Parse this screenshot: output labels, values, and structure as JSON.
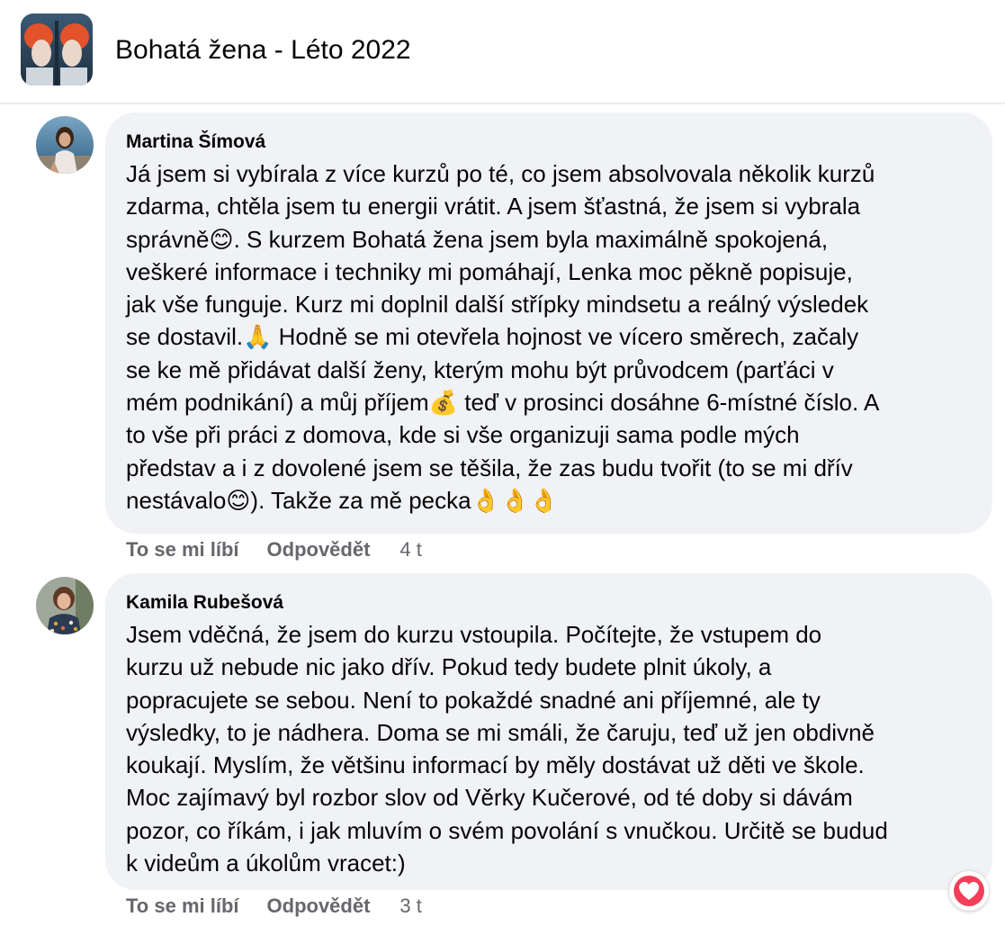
{
  "header": {
    "group_title": "Bohatá žena - Léto 2022",
    "group_avatar_icon": "group-photo-icon"
  },
  "comments": [
    {
      "author": "Martina Šímová",
      "lines": [
        "Já jsem si vybírala z více kurzů po té, co jsem absolvovala několik kurzů",
        "zdarma, chtěla jsem tu energii vrátit. A jsem šťastná, že jsem si vybrala",
        "správně😊. S kurzem Bohatá žena jsem byla maximálně spokojená,",
        "veškeré informace i techniky mi pomáhají, Lenka moc pěkně popisuje,",
        "jak vše funguje. Kurz mi doplnil další střípky mindsetu a reálný výsledek",
        "se dostavil.🙏 Hodně se mi otevřela hojnost ve vícero směrech, začaly",
        "se ke mě přidávat další ženy, kterým mohu být průvodcem (parťáci v",
        "mém podnikání) a můj příjem💰 teď v prosinci dosáhne 6-místné číslo. A",
        "to vše při práci z domova, kde si vše organizuji sama podle mých",
        "představ a i z dovolené jsem se těšila, že zas budu tvořit (to se mi dřív",
        "nestávalo😊). Takže za mě pecka👌👌👌"
      ],
      "like_label": "To se mi líbí",
      "reply_label": "Odpovědět",
      "time": "4 t"
    },
    {
      "author": "Kamila Rubešová",
      "lines": [
        "Jsem vděčná, že jsem do kurzu vstoupila. Počítejte, že vstupem do",
        "kurzu už nebude nic jako dřív. Pokud tedy budete plnit úkoly, a",
        "popracujete se sebou. Není to pokaždé snadné ani příjemné, ale ty",
        "výsledky, to je nádhera. Doma se mi smáli, že čaruju, teď už jen obdivně",
        "koukají. Myslím, že většinu informací by měly dostávat už děti ve škole.",
        "Moc zajímavý byl rozbor slov od Věrky Kučerové, od té doby si dávám",
        "pozor, co říkám, i jak mluvím o svém povolání s vnučkou. Určitě se budud",
        "k videům a úkolům vracet:)"
      ],
      "like_label": "To se mi líbí",
      "reply_label": "Odpovědět",
      "time": "3 t",
      "reaction_icon": "love-reaction-icon"
    }
  ],
  "colors": {
    "bubble_bg": "#f0f2f5",
    "action_text": "#65676b",
    "love_reaction": "#f33e58"
  }
}
